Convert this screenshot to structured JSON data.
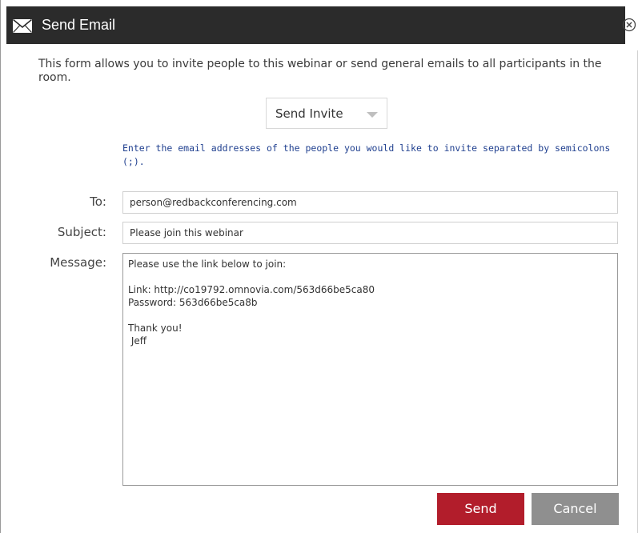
{
  "window": {
    "title": "Send Email",
    "title_icon": "envelope-icon",
    "close_icon": "close-circle-icon"
  },
  "intro_text": "This form allows you to invite people to this webinar or send general emails to all participants in the room.",
  "mode_select": {
    "selected": "Send Invite",
    "icon": "chevron-down-icon"
  },
  "hint_text": "Enter the email addresses of the people you would like to invite separated by semicolons (;).",
  "form": {
    "to": {
      "label": "To:",
      "value": "person@redbackconferencing.com"
    },
    "subject": {
      "label": "Subject:",
      "value": "Please join this webinar"
    },
    "message": {
      "label": "Message:",
      "value": "Please use the link below to join:\n\nLink: http://co19792.omnovia.com/563d66be5ca80\nPassword: 563d66be5ca8b\n\nThank you!\n Jeff"
    }
  },
  "buttons": {
    "send": "Send",
    "cancel": "Cancel"
  },
  "colors": {
    "titlebar": "#2b2b2b",
    "send_button": "#b21d2b",
    "cancel_button": "#8f8f8f",
    "hint_text": "#1f3f8f"
  }
}
